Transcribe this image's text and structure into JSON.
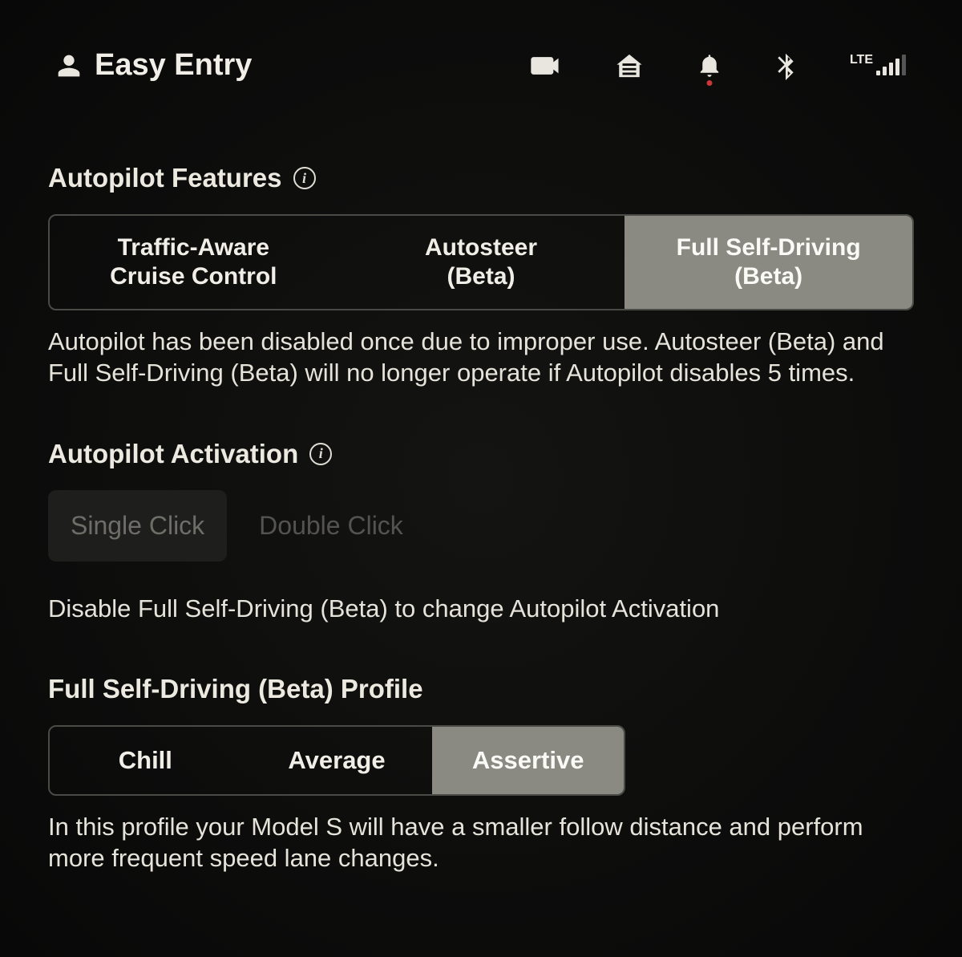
{
  "header": {
    "profile_name": "Easy Entry",
    "network_label": "LTE"
  },
  "autopilot_features": {
    "title": "Autopilot Features",
    "options": [
      "Traffic-Aware Cruise Control",
      "Autosteer (Beta)",
      "Full Self-Driving (Beta)"
    ],
    "selected_index": 2,
    "warning": "Autopilot has been disabled once due to improper use. Autosteer (Beta) and Full Self-Driving (Beta) will no longer operate if Autopilot disables 5 times."
  },
  "autopilot_activation": {
    "title": "Autopilot Activation",
    "options": [
      "Single Click",
      "Double Click"
    ],
    "selected_index": 0,
    "disabled": true,
    "note": "Disable Full Self-Driving (Beta) to change Autopilot Activation"
  },
  "fsd_profile": {
    "title": "Full Self-Driving (Beta) Profile",
    "options": [
      "Chill",
      "Average",
      "Assertive"
    ],
    "selected_index": 2,
    "description": "In this profile your Model S will have a smaller follow distance and perform more frequent speed lane changes."
  }
}
